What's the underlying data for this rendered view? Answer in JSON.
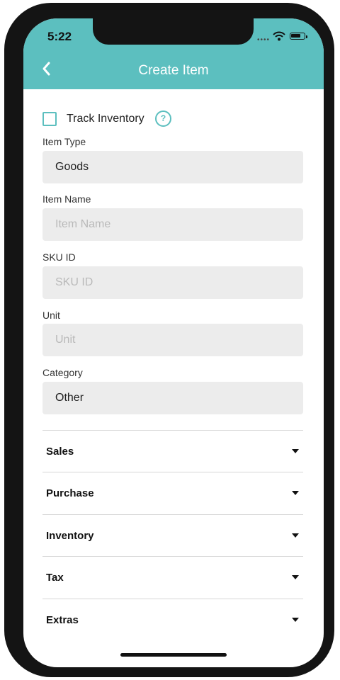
{
  "status_bar": {
    "time": "5:22"
  },
  "header": {
    "title": "Create Item"
  },
  "track_inventory": {
    "label": "Track Inventory",
    "checked": false
  },
  "form": {
    "item_type": {
      "label": "Item Type",
      "value": "Goods"
    },
    "item_name": {
      "label": "Item Name",
      "placeholder": "Item Name"
    },
    "sku_id": {
      "label": "SKU ID",
      "placeholder": "SKU ID"
    },
    "unit": {
      "label": "Unit",
      "placeholder": "Unit"
    },
    "category": {
      "label": "Category",
      "value": "Other"
    }
  },
  "sections": [
    "Sales",
    "Purchase",
    "Inventory",
    "Tax",
    "Extras"
  ],
  "colors": {
    "accent": "#5cbfbf"
  }
}
